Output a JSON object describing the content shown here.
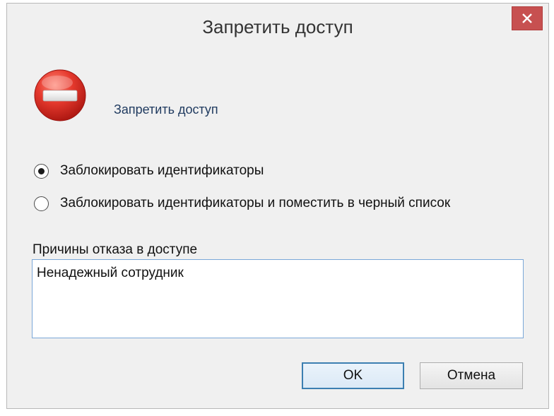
{
  "window": {
    "title": "Запретить доступ",
    "close_icon": "close-icon"
  },
  "dialog": {
    "heading": "Запретить доступ",
    "icon": "stop-icon",
    "options": [
      {
        "label": "Заблокировать идентификаторы",
        "checked": true
      },
      {
        "label": "Заблокировать идентификаторы и поместить в черный список",
        "checked": false
      }
    ],
    "reason_label": "Причины отказа в доступе",
    "reason_value": "Ненадежный сотрудник"
  },
  "buttons": {
    "ok_label": "OK",
    "cancel_label": "Отмена"
  },
  "colors": {
    "close_button_bg": "#c75050",
    "focus_border": "#3c7fb1",
    "heading_text": "#1f3a5f",
    "stop_icon_red": "#d9302a"
  }
}
